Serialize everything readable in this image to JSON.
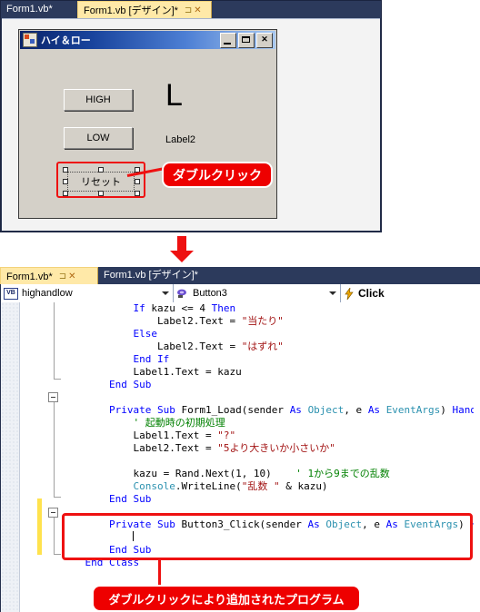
{
  "designer": {
    "tabs": [
      {
        "label": "Form1.vb*",
        "active": false
      },
      {
        "label": "Form1.vb [デザイン]*",
        "active": true
      }
    ],
    "tab_icons": {
      "pin": "⊐",
      "close": "✕"
    },
    "form": {
      "title": "ハイ＆ロー",
      "icon": "vb-form-icon",
      "window_buttons": {
        "minimize": "",
        "maximize": "",
        "close": "✕"
      },
      "buttons": [
        {
          "name": "Button1",
          "text": "HIGH"
        },
        {
          "name": "Button2",
          "text": "LOW"
        },
        {
          "name": "Button3",
          "text": "リセット",
          "selected": true
        }
      ],
      "labels": [
        {
          "name": "Label1",
          "text": "L"
        },
        {
          "name": "Label2",
          "text": "Label2"
        }
      ]
    },
    "callout": {
      "text": "ダブルクリック",
      "color": "#ee0000"
    }
  },
  "flow": {
    "arrow": "down-arrow",
    "color": "#ee1111"
  },
  "code": {
    "tabs": [
      {
        "label": "Form1.vb*",
        "active": true
      },
      {
        "label": "Form1.vb [デザイン]*",
        "active": false
      }
    ],
    "toolbar": {
      "class_combo": {
        "value": "highandlow",
        "icon": "vb-class-icon"
      },
      "member_combo": {
        "value": "Button3",
        "icon": "method-icon"
      },
      "event_combo": {
        "value": "Click",
        "icon": "lightning-icon"
      }
    },
    "lines": [
      {
        "indent": 12,
        "segments": [
          {
            "t": "If ",
            "c": "kw"
          },
          {
            "t": "kazu <= 4 ",
            "c": "pln"
          },
          {
            "t": "Then",
            "c": "kw"
          }
        ]
      },
      {
        "indent": 16,
        "segments": [
          {
            "t": "Label2.Text = ",
            "c": "pln"
          },
          {
            "t": "\"当たり\"",
            "c": "str"
          }
        ]
      },
      {
        "indent": 12,
        "segments": [
          {
            "t": "Else",
            "c": "kw"
          }
        ]
      },
      {
        "indent": 16,
        "segments": [
          {
            "t": "Label2.Text = ",
            "c": "pln"
          },
          {
            "t": "\"はずれ\"",
            "c": "str"
          }
        ]
      },
      {
        "indent": 12,
        "segments": [
          {
            "t": "End If",
            "c": "kw"
          }
        ]
      },
      {
        "indent": 12,
        "segments": [
          {
            "t": "Label1.Text = kazu",
            "c": "pln"
          }
        ]
      },
      {
        "indent": 8,
        "segments": [
          {
            "t": "End Sub",
            "c": "kw"
          }
        ]
      },
      {
        "indent": 0,
        "segments": []
      },
      {
        "indent": 8,
        "segments": [
          {
            "t": "Private Sub ",
            "c": "kw"
          },
          {
            "t": "Form1_Load(sender ",
            "c": "pln"
          },
          {
            "t": "As ",
            "c": "kw"
          },
          {
            "t": "Object",
            "c": "typ"
          },
          {
            "t": ", e ",
            "c": "pln"
          },
          {
            "t": "As ",
            "c": "kw"
          },
          {
            "t": "EventArgs",
            "c": "typ"
          },
          {
            "t": ") ",
            "c": "pln"
          },
          {
            "t": "Handles",
            "c": "kw"
          }
        ]
      },
      {
        "indent": 12,
        "segments": [
          {
            "t": "' 起動時の初期処理",
            "c": "cmt"
          }
        ]
      },
      {
        "indent": 12,
        "segments": [
          {
            "t": "Label1.Text = ",
            "c": "pln"
          },
          {
            "t": "\"?\"",
            "c": "str"
          }
        ]
      },
      {
        "indent": 12,
        "segments": [
          {
            "t": "Label2.Text = ",
            "c": "pln"
          },
          {
            "t": "\"5より大きいか小さいか\"",
            "c": "str"
          }
        ]
      },
      {
        "indent": 0,
        "segments": []
      },
      {
        "indent": 12,
        "segments": [
          {
            "t": "kazu = Rand.Next(1, 10)",
            "c": "pln"
          },
          {
            "t": "    ' 1から9までの乱数",
            "c": "cmt"
          }
        ]
      },
      {
        "indent": 12,
        "segments": [
          {
            "t": "Console",
            "c": "typ"
          },
          {
            "t": ".WriteLine(",
            "c": "pln"
          },
          {
            "t": "\"乱数 \"",
            "c": "str"
          },
          {
            "t": " & kazu)",
            "c": "pln"
          }
        ]
      },
      {
        "indent": 8,
        "segments": [
          {
            "t": "End Sub",
            "c": "kw"
          }
        ]
      },
      {
        "indent": 0,
        "segments": []
      },
      {
        "indent": 8,
        "segments": [
          {
            "t": "Private Sub ",
            "c": "kw"
          },
          {
            "t": "Button3_Click(sender ",
            "c": "pln"
          },
          {
            "t": "As ",
            "c": "kw"
          },
          {
            "t": "Object",
            "c": "typ"
          },
          {
            "t": ", e ",
            "c": "pln"
          },
          {
            "t": "As ",
            "c": "kw"
          },
          {
            "t": "EventArgs",
            "c": "typ"
          },
          {
            "t": ") ",
            "c": "pln"
          },
          {
            "t": "Han",
            "c": "kw"
          }
        ]
      },
      {
        "indent": 12,
        "segments": []
      },
      {
        "indent": 8,
        "segments": [
          {
            "t": "End Sub",
            "c": "kw"
          }
        ]
      },
      {
        "indent": 4,
        "segments": [
          {
            "t": "End Class",
            "c": "kw"
          }
        ]
      }
    ],
    "callout": {
      "text": "ダブルクリックにより追加されたプログラム",
      "color": "#ee0000"
    }
  }
}
